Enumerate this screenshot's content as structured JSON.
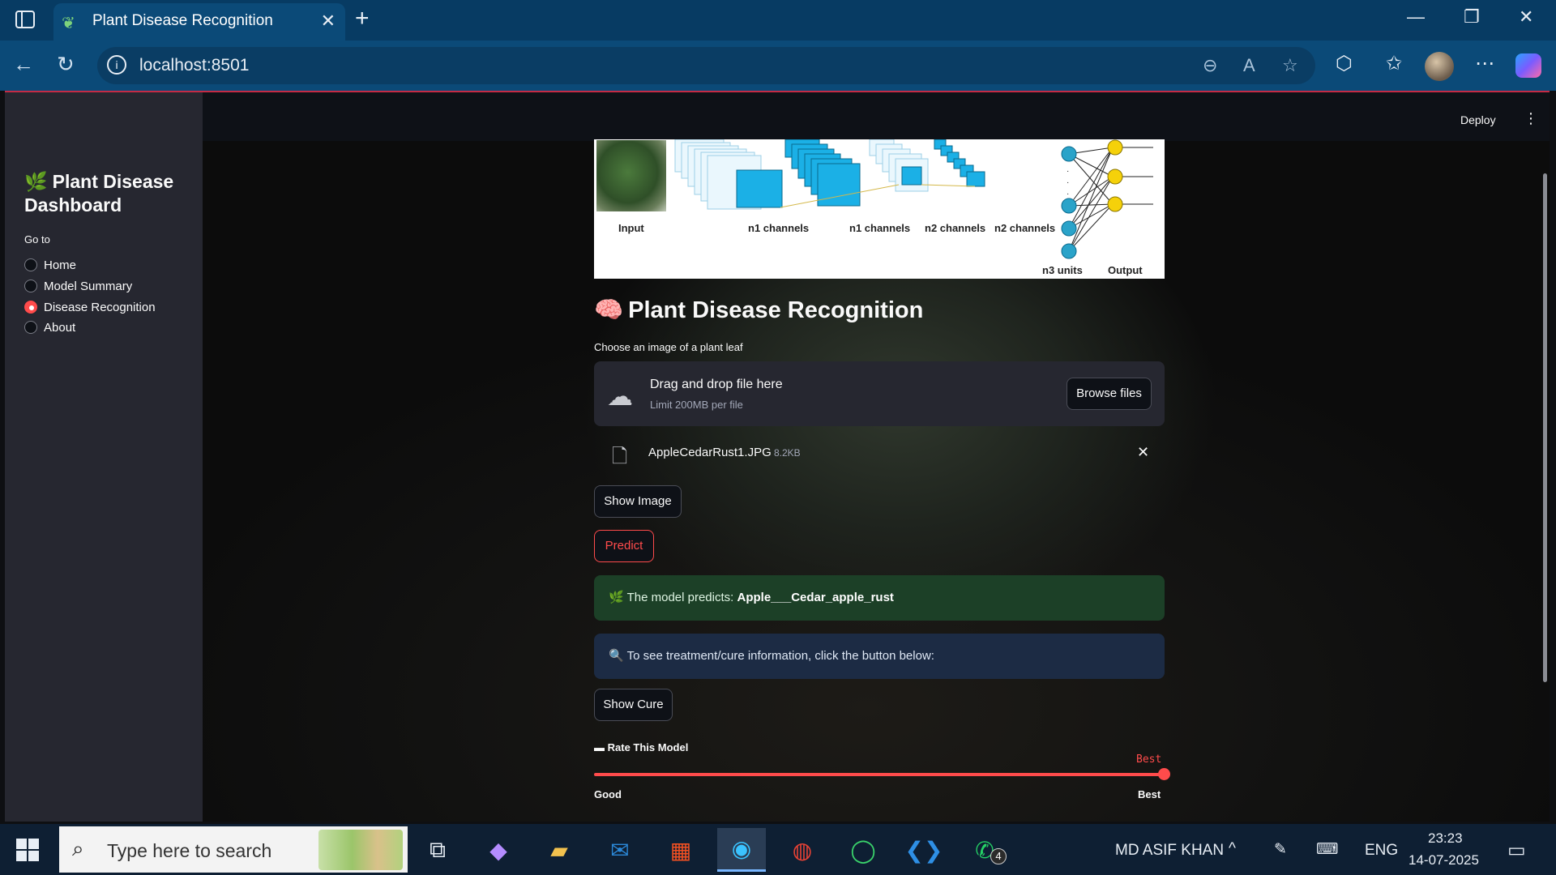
{
  "browser": {
    "tab_title": "Plant Disease Recognition",
    "url": "localhost:8501"
  },
  "streamlit": {
    "deploy_label": "Deploy"
  },
  "sidebar": {
    "title": "Plant Disease Dashboard",
    "goto_label": "Go to",
    "items": [
      {
        "label": "Home",
        "selected": false
      },
      {
        "label": "Model Summary",
        "selected": false
      },
      {
        "label": "Disease Recognition",
        "selected": true
      },
      {
        "label": "About",
        "selected": false
      }
    ]
  },
  "diagram": {
    "labels": [
      "Input",
      "n1 channels",
      "n1 channels",
      "n2 channels",
      "n2 channels",
      "n3 units",
      "Output"
    ]
  },
  "main": {
    "title": "Plant Disease Recognition",
    "uploader": {
      "label": "Choose an image of a plant leaf",
      "drop_text": "Drag and drop file here",
      "limit_text": "Limit 200MB per file",
      "browse_label": "Browse files"
    },
    "file": {
      "name": "AppleCedarRust1.JPG",
      "size": "8.2KB"
    },
    "show_image_label": "Show Image",
    "predict_label": "Predict",
    "prediction_prefix": "The model predicts:",
    "prediction_value": "Apple___Cedar_apple_rust",
    "info_text": "To see treatment/cure information, click the button below:",
    "show_cure_label": "Show Cure",
    "rate_label": "Rate This Model",
    "slider": {
      "value": "Best",
      "min_label": "Good",
      "max_label": "Best",
      "position": 1.0
    }
  },
  "taskbar": {
    "search_placeholder": "Type here to search",
    "user_name": "MD ASIF KHAN",
    "language": "ENG",
    "time": "23:23",
    "date": "14-07-2025",
    "whatsapp_badge": "4"
  },
  "colors": {
    "accent": "#ff4b4b",
    "success_bg": "#1c4027",
    "info_bg": "#1c2b44",
    "sidebar_bg": "#262730"
  }
}
